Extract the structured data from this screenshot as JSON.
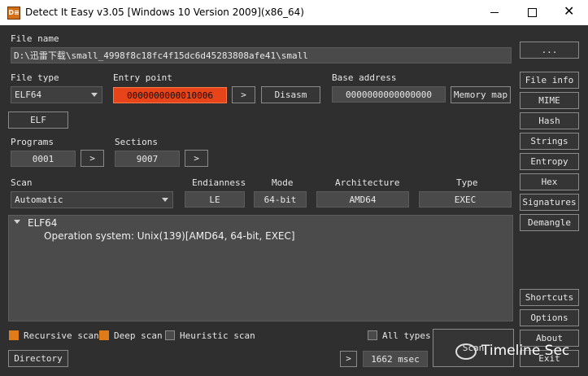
{
  "titlebar": {
    "app_icon_text": "D≡",
    "title": "Detect It Easy v3.05 [Windows 10 Version 2009](x86_64)",
    "minimize_icon": "minimize-icon",
    "maximize_icon": "maximize-icon",
    "close_symbol": "✕"
  },
  "file": {
    "label": "File name",
    "path": "D:\\迅雷下载\\small_4998f8c18fc4f15dc6d45283808afe41\\small",
    "browse_label": "..."
  },
  "file_type": {
    "label": "File type",
    "value": "ELF64"
  },
  "entry_point": {
    "label": "Entry point",
    "value": "0000000000010006",
    "go_label": ">",
    "disasm_label": "Disasm"
  },
  "base_address": {
    "label": "Base address",
    "value": "0000000000000000",
    "memory_map_label": "Memory map"
  },
  "elf_button_label": "ELF",
  "programs": {
    "label": "Programs",
    "value": "0001",
    "go_label": ">"
  },
  "sections": {
    "label": "Sections",
    "value": "9007",
    "go_label": ">"
  },
  "scan": {
    "label": "Scan",
    "value": "Automatic"
  },
  "endianness": {
    "label": "Endianness",
    "value": "LE"
  },
  "mode": {
    "label": "Mode",
    "value": "64-bit"
  },
  "architecture": {
    "label": "Architecture",
    "value": "AMD64"
  },
  "type": {
    "label": "Type",
    "value": "EXEC"
  },
  "results": {
    "title": "ELF64",
    "line": "Operation system: Unix(139)[AMD64, 64-bit, EXEC]"
  },
  "side_buttons": {
    "file_info": "File info",
    "mime": "MIME",
    "hash": "Hash",
    "strings": "Strings",
    "entropy": "Entropy",
    "hex": "Hex",
    "signatures": "Signatures",
    "demangle": "Demangle",
    "shortcuts": "Shortcuts",
    "options": "Options",
    "about": "About",
    "exit": "Exit"
  },
  "options": {
    "recursive_scan": "Recursive scan",
    "deep_scan": "Deep scan",
    "heuristic_scan": "Heuristic scan",
    "all_types": "All types",
    "recursive_checked": true,
    "deep_checked": true,
    "heuristic_checked": false,
    "all_types_checked": false
  },
  "bottom": {
    "directory_label": "Directory",
    "go_label": ">",
    "elapsed": "1662 msec",
    "scan_label": "Scan"
  },
  "watermark": {
    "text": "Timeline Sec",
    "logo_icon": "wechat-logo-icon"
  },
  "colors": {
    "accent_orange": "#e07b1a",
    "entry_point_bg": "#e8441a",
    "background": "#2f2f2f"
  }
}
